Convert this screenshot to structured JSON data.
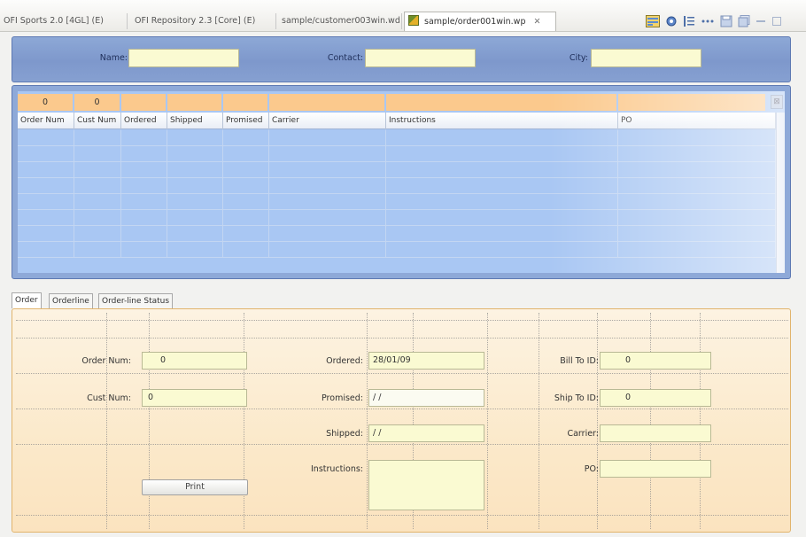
{
  "editor_tabs": {
    "tab1": "OFI Sports 2.0 [4GL]",
    "tab1_ext": "(E)",
    "tab2": "OFI Repository 2.3 [Core]",
    "tab2_ext": "(E)",
    "tab3": "sample/customer003win.wd",
    "tab4_active": "sample/order001win.wp",
    "close_glyph": "✕"
  },
  "filter": {
    "name_label": "Name:",
    "contact_label": "Contact:",
    "city_label": "City:",
    "name_value": "",
    "contact_value": "",
    "city_value": ""
  },
  "grid": {
    "summary": [
      "0",
      "0",
      "",
      "",
      "",
      "",
      "",
      ""
    ],
    "columns": [
      "Order Num",
      "Cust Num",
      "Ordered",
      "Shipped",
      "Promised",
      "Carrier",
      "Instructions",
      "PO"
    ],
    "rows": [
      [
        "",
        "",
        "",
        "",
        "",
        "",
        "",
        ""
      ],
      [
        "",
        "",
        "",
        "",
        "",
        "",
        "",
        ""
      ],
      [
        "",
        "",
        "",
        "",
        "",
        "",
        "",
        ""
      ],
      [
        "",
        "",
        "",
        "",
        "",
        "",
        "",
        ""
      ],
      [
        "",
        "",
        "",
        "",
        "",
        "",
        "",
        ""
      ],
      [
        "",
        "",
        "",
        "",
        "",
        "",
        "",
        ""
      ],
      [
        "",
        "",
        "",
        "",
        "",
        "",
        "",
        ""
      ],
      [
        "",
        "",
        "",
        "",
        "",
        "",
        "",
        ""
      ]
    ]
  },
  "form_tabs": [
    "Order",
    "Orderline",
    "Order-line Status"
  ],
  "form": {
    "order_num_label": "Order Num:",
    "order_num_value": "0",
    "cust_num_label": "Cust Num:",
    "cust_num_value": "0",
    "ordered_label": "Ordered:",
    "ordered_value": "28/01/09",
    "promised_label": "Promised:",
    "promised_value": "/ /",
    "shipped_label": "Shipped:",
    "shipped_value": "/ /",
    "instructions_label": "Instructions:",
    "instructions_value": "",
    "bill_to_label": "Bill To ID:",
    "bill_to_value": "0",
    "ship_to_label": "Ship To ID:",
    "ship_to_value": "0",
    "carrier_label": "Carrier:",
    "carrier_value": "",
    "po_label": "PO:",
    "po_value": "",
    "print_label": "Print"
  },
  "colors": {
    "filter_panel": "#7e98cc",
    "grid_rows": "#a9c7f3",
    "summary_cells": "#fbc98d",
    "field_fill": "#fafad2",
    "form_panel": "#fbe9ca"
  }
}
